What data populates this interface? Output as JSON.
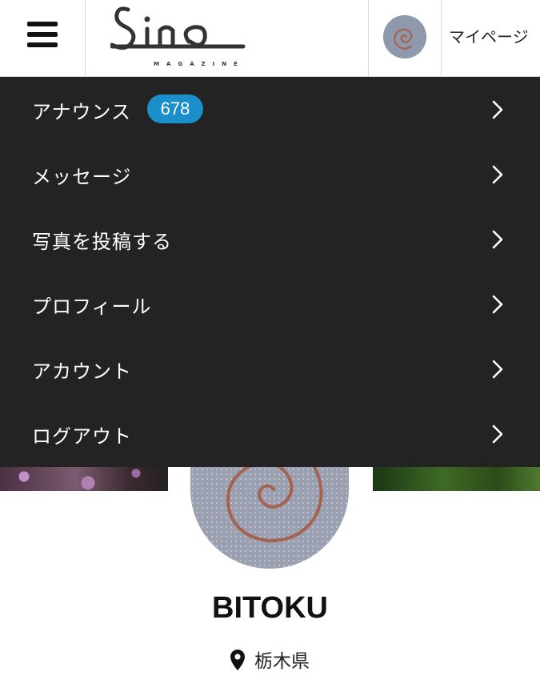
{
  "header": {
    "menu_icon": "hamburger-icon",
    "logo_text": "Sino",
    "logo_subtext": "MAGAZINE",
    "mypage_label": "マイページ"
  },
  "menu": {
    "items": [
      {
        "label": "アナウンス",
        "badge": "678",
        "icon": "chevron-right-icon"
      },
      {
        "label": "メッセージ",
        "icon": "chevron-right-icon"
      },
      {
        "label": "写真を投稿する",
        "icon": "chevron-right-icon"
      },
      {
        "label": "プロフィール",
        "icon": "chevron-right-icon"
      },
      {
        "label": "アカウント",
        "icon": "chevron-right-icon"
      },
      {
        "label": "ログアウト",
        "icon": "chevron-right-icon"
      }
    ]
  },
  "profile": {
    "name": "BITOKU",
    "location": "栃木県",
    "location_icon": "map-pin-icon"
  },
  "colors": {
    "menu_background": "#232323",
    "badge": "#1a8fc9",
    "header_background": "#ffffff"
  }
}
